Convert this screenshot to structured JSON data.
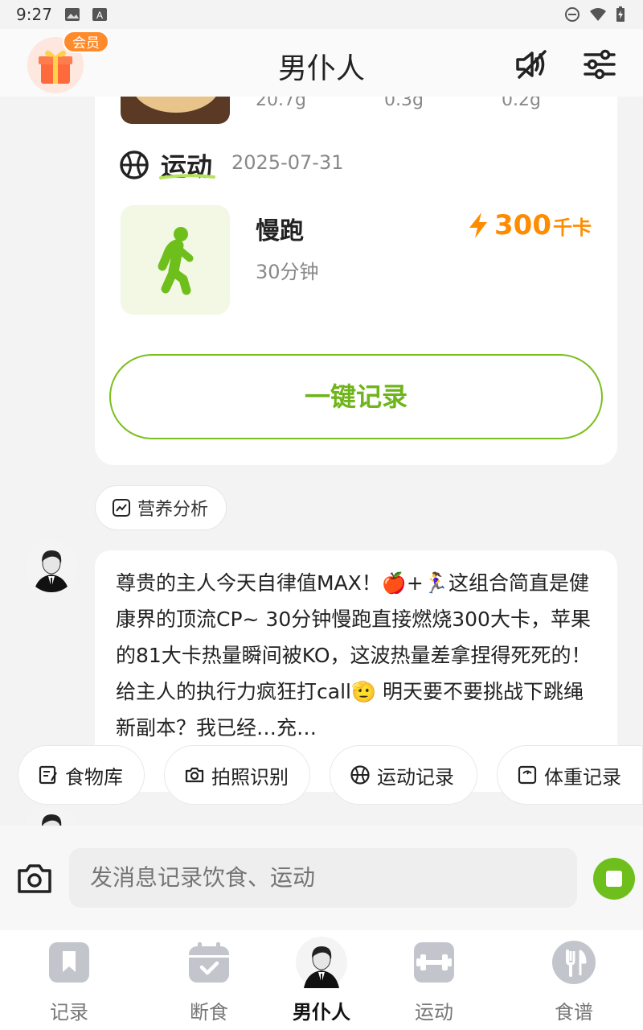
{
  "status_bar": {
    "time": "9:27",
    "icons": [
      "image-icon",
      "font-icon",
      "dnd-icon",
      "wifi-icon",
      "battery-icon"
    ]
  },
  "header": {
    "vip_badge": "会员",
    "title": "男仆人",
    "icons": [
      "gift-icon",
      "mute-icon",
      "settings-sliders-icon"
    ]
  },
  "card": {
    "nutrition_values": [
      "20.7g",
      "0.3g",
      "0.2g"
    ],
    "exercise": {
      "section_title": "运动",
      "date": "2025-07-31",
      "name": "慢跑",
      "duration": "30分钟",
      "kcal_value": "300",
      "kcal_unit": "千卡"
    },
    "record_button": "一键记录"
  },
  "analysis_chip": "营养分析",
  "chat": {
    "message": "尊贵的主人今天自律值MAX！🍎+🏃‍♀️这组合简直是健康界的顶流CP~ 30分钟慢跑直接燃烧300大卡，苹果的81大卡热量瞬间被KO，这波热量差拿捏得死死的！给主人的执行力疯狂打call🫡 明天要不要挑战下跳绳新副本？我已经…充…"
  },
  "quick_actions": [
    {
      "label": "食物库",
      "icon": "food-library-icon"
    },
    {
      "label": "拍照识别",
      "icon": "camera-icon"
    },
    {
      "label": "运动记录",
      "icon": "basketball-icon"
    },
    {
      "label": "体重记录",
      "icon": "scale-icon"
    }
  ],
  "input": {
    "placeholder": "发消息记录饮食、运动"
  },
  "tabs": [
    {
      "label": "记录",
      "active": false
    },
    {
      "label": "断食",
      "active": false
    },
    {
      "label": "男仆人",
      "active": true
    },
    {
      "label": "运动",
      "active": false
    },
    {
      "label": "食谱",
      "active": false
    }
  ],
  "colors": {
    "accent_green": "#6ebf1c",
    "kcal_orange": "#ff8c00",
    "vip_orange": "#ff8a2a"
  }
}
